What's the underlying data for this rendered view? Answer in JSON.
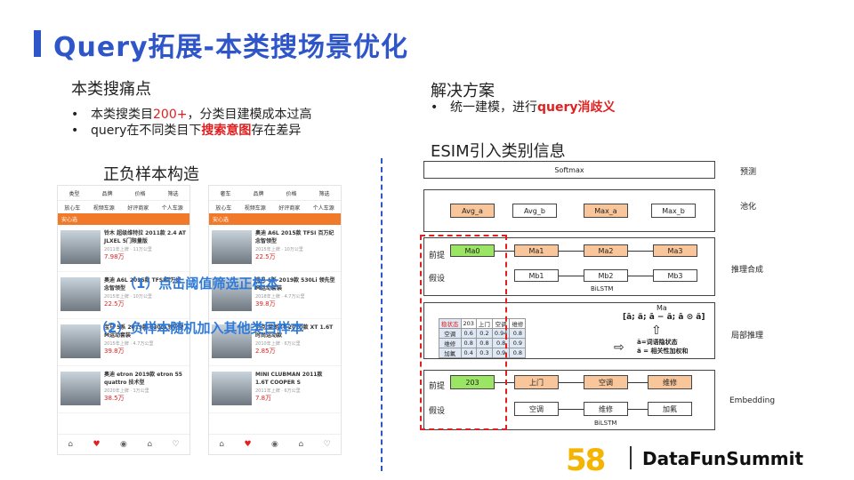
{
  "title": "Query拓展-本类搜场景优化",
  "left": {
    "heading": "本类搜痛点",
    "bullets": [
      {
        "pre": "本类搜类目",
        "hl": "200+",
        "post": "，分类目建模成本过高"
      },
      {
        "pre": "query在不同类目下",
        "hl": "搜索意图",
        "post": "存在差异"
      }
    ],
    "subheading": "正负样本构造",
    "overlay1": "（1）点击阈值筛选正样本",
    "overlay2": "（2）负样本随机加入其他类目样本"
  },
  "phone1": {
    "filters": [
      "类型",
      "品牌",
      "价格",
      "筛选"
    ],
    "tags": [
      "放心车",
      "视频车源",
      "好评商家",
      "个人车源"
    ],
    "banner": "安心选",
    "items": [
      {
        "name": "铃木 超级维特拉 2011款 2.4 AT JLXEL 5门限量版",
        "meta": "2011年上牌 · 11万公里",
        "price": "7.98万"
      },
      {
        "name": "奥迪 A6L 2015款 TFSI百万纪念智领型",
        "meta": "2015年上牌 · 10万公里",
        "price": "22.5万"
      },
      {
        "name": "宝马 5系 2019款 530Li 领先型 M运动套装",
        "meta": "2015年上牌 · 4.7万公里",
        "price": "39.8万"
      },
      {
        "name": "奥迪 etron 2019款 etron 55 quattro 技术型",
        "meta": "2020年上牌 · 1万公里",
        "price": "38.5万"
      }
    ],
    "nav": [
      "⌂",
      "♥",
      "◉",
      "⌂",
      "♡"
    ]
  },
  "phone2": {
    "filters": [
      "奢车",
      "品牌",
      "价格",
      "筛选"
    ],
    "tags": [
      "放心车",
      "视频车源",
      "好评商家",
      "个人车源"
    ],
    "banner": "安心选",
    "items": [
      {
        "name": "奥迪 A6L 2015款 TFSI 百万纪念智领型",
        "meta": "2015年上牌 · 10万公里",
        "price": "22.5万"
      },
      {
        "name": "宝马 5系 2019款 530Li 领先型 M运动套装",
        "meta": "2018年上牌 · 4.7万公里",
        "price": "39.8万"
      },
      {
        "name": "别克 英朗XT 2010款 XT 1.6T 时尚运动款",
        "meta": "2010年上牌 · 6万公里",
        "price": "2.85万"
      },
      {
        "name": "MINI CLUBMAN 2011款 1.6T COOPER S",
        "meta": "2011年上牌 · 6万公里",
        "price": "7.8万"
      }
    ],
    "nav": [
      "⌂",
      "♥",
      "◉",
      "⌂",
      "♡"
    ]
  },
  "right": {
    "heading": "解决方案",
    "bullet": {
      "pre": "统一建模，进行",
      "hl": "query消歧义"
    },
    "esim": "ESIM引入类别信息"
  },
  "diagram": {
    "softmax": "Softmax",
    "pool": [
      "Avg_a",
      "Avg_b",
      "Max_a",
      "Max_b"
    ],
    "inf_a": [
      "Ma0",
      "Ma1",
      "Ma2",
      "Ma3"
    ],
    "inf_b": [
      "Mb1",
      "Mb2",
      "Mb3"
    ],
    "premise": "前提",
    "hypothesis": "假设",
    "bilstm": "BiLSTM",
    "formula_top": "Ma",
    "formula": "[ā; ã; ā − ã; ā ⊙ ã]",
    "notes": [
      "ā=词语隐状态",
      "ã = 相关性加权和"
    ],
    "att_table": [
      [
        "稳状态",
        "203",
        "上门",
        "空调",
        "维修"
      ],
      [
        "空调",
        "0.6",
        "0.2",
        "0.94",
        "0.8"
      ],
      [
        "维修",
        "0.8",
        "0.8",
        "0.8",
        "0.9"
      ],
      [
        "加氟",
        "0.4",
        "0.3",
        "0.9",
        "0.8"
      ]
    ],
    "emb_a": [
      "203",
      "上门",
      "空调",
      "维修"
    ],
    "emb_b": [
      "空调",
      "维修",
      "加氟"
    ],
    "layers": [
      "预测",
      "池化",
      "推理合成",
      "局部推理",
      "Embedding"
    ]
  },
  "logo": {
    "num": "58",
    "text": "DataFunSummit"
  }
}
